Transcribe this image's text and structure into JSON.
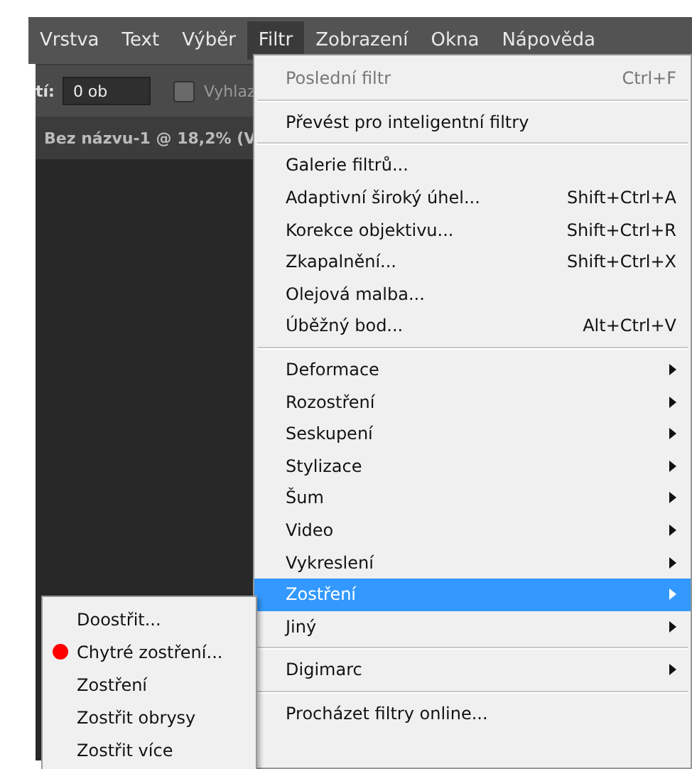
{
  "menubar": [
    {
      "label": "Vrstva",
      "selected": false
    },
    {
      "label": "Text",
      "selected": false
    },
    {
      "label": "Výběr",
      "selected": false
    },
    {
      "label": "Filtr",
      "selected": true
    },
    {
      "label": "Zobrazení",
      "selected": false
    },
    {
      "label": "Okna",
      "selected": false
    },
    {
      "label": "Nápověda",
      "selected": false
    }
  ],
  "options_bar": {
    "label": "tí:",
    "field_value": "0 ob",
    "checkbox": {
      "label": "Vyhlaz",
      "checked": false
    }
  },
  "document_tab": "Bez názvu-1 @ 18,2% (V",
  "filter_menu": {
    "sections": [
      [
        {
          "label": "Poslední filtr",
          "shortcut": "Ctrl+F",
          "disabled": true,
          "submenu": false,
          "selected": false
        }
      ],
      [
        {
          "label": "Převést pro inteligentní filtry",
          "disabled": false,
          "submenu": false,
          "selected": false
        }
      ],
      [
        {
          "label": "Galerie filtrů...",
          "disabled": false,
          "submenu": false,
          "selected": false
        },
        {
          "label": "Adaptivní široký úhel...",
          "shortcut": "Shift+Ctrl+A",
          "disabled": false,
          "submenu": false,
          "selected": false
        },
        {
          "label": "Korekce objektivu...",
          "shortcut": "Shift+Ctrl+R",
          "disabled": false,
          "submenu": false,
          "selected": false
        },
        {
          "label": "Zkapalnění...",
          "shortcut": "Shift+Ctrl+X",
          "disabled": false,
          "submenu": false,
          "selected": false
        },
        {
          "label": "Olejová malba...",
          "disabled": false,
          "submenu": false,
          "selected": false
        },
        {
          "label": "Úběžný bod...",
          "shortcut": "Alt+Ctrl+V",
          "disabled": false,
          "submenu": false,
          "selected": false
        }
      ],
      [
        {
          "label": "Deformace",
          "disabled": false,
          "submenu": true,
          "selected": false
        },
        {
          "label": "Rozostření",
          "disabled": false,
          "submenu": true,
          "selected": false
        },
        {
          "label": "Seskupení",
          "disabled": false,
          "submenu": true,
          "selected": false
        },
        {
          "label": "Stylizace",
          "disabled": false,
          "submenu": true,
          "selected": false
        },
        {
          "label": "Šum",
          "disabled": false,
          "submenu": true,
          "selected": false
        },
        {
          "label": "Video",
          "disabled": false,
          "submenu": true,
          "selected": false
        },
        {
          "label": "Vykreslení",
          "disabled": false,
          "submenu": true,
          "selected": false
        },
        {
          "label": "Zostření",
          "disabled": false,
          "submenu": true,
          "selected": true
        },
        {
          "label": "Jiný",
          "disabled": false,
          "submenu": true,
          "selected": false
        }
      ],
      [
        {
          "label": "Digimarc",
          "disabled": false,
          "submenu": true,
          "selected": false
        }
      ],
      [
        {
          "label": "Procházet filtry online...",
          "disabled": false,
          "submenu": false,
          "selected": false
        }
      ]
    ]
  },
  "submenu": {
    "items": [
      {
        "label": "Doostřit...",
        "marked": false
      },
      {
        "label": "Chytré zostření...",
        "marked": true
      },
      {
        "label": "Zostření",
        "marked": false
      },
      {
        "label": "Zostřit obrysy",
        "marked": false
      },
      {
        "label": "Zostřit více",
        "marked": false
      }
    ]
  }
}
